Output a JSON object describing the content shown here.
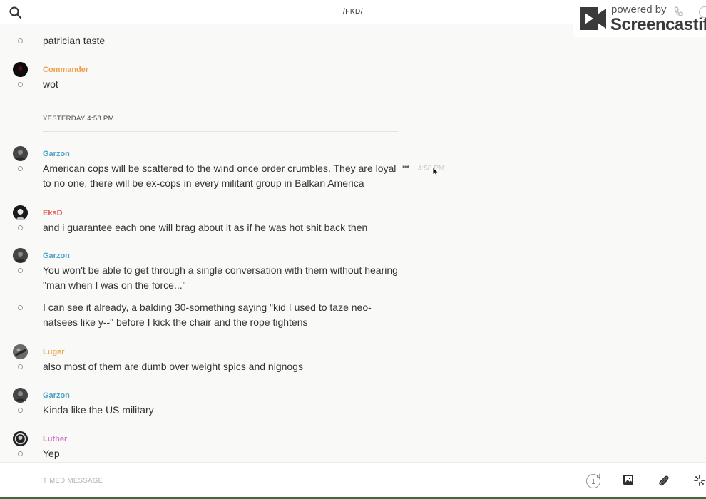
{
  "header": {
    "channel_title": "/FKD/"
  },
  "watermark": {
    "powered_by": "powered by",
    "brand": "Screencastify"
  },
  "colors": {
    "orange_user": "#f0a04b",
    "blue_user": "#4ba3c7",
    "red_user": "#dc5b55",
    "pink_user": "#d874c8"
  },
  "messages": [
    {
      "text": "patrician taste"
    },
    {
      "username": "Commander",
      "text": "wot"
    },
    {
      "divider": "YESTERDAY 4:58 PM"
    },
    {
      "username": "Garzon",
      "text": "American cops will be scattered to the wind once order crumbles. They are loyal to no one, there will be ex-cops in every militant group in Balkan America",
      "hover_time": "4:58 PM"
    },
    {
      "username": "EksD",
      "text": "and i guarantee each one will brag about it as if he was hot shit back then"
    },
    {
      "username": "Garzon",
      "text": "You won't be able to get through a single conversation with them without hearing \"man when I was on the force...\""
    },
    {
      "text": "I can see it already, a balding 30-something saying \"kid I used to taze neo-natsees like y--\" before I kick the chair and the rope tightens"
    },
    {
      "username": "Luger",
      "text": "also most of them are dumb over weight spics and nignogs"
    },
    {
      "username": "Garzon",
      "text": "Kinda like the US military"
    },
    {
      "username": "Luther",
      "text": "Yep"
    }
  ],
  "composer": {
    "placeholder": "TIMED MESSAGE",
    "timer_value": "1",
    "timer_unit": "d"
  },
  "icons": [
    "search-icon",
    "more-icon",
    "image-icon",
    "attachment-icon",
    "sparkle-icon"
  ]
}
